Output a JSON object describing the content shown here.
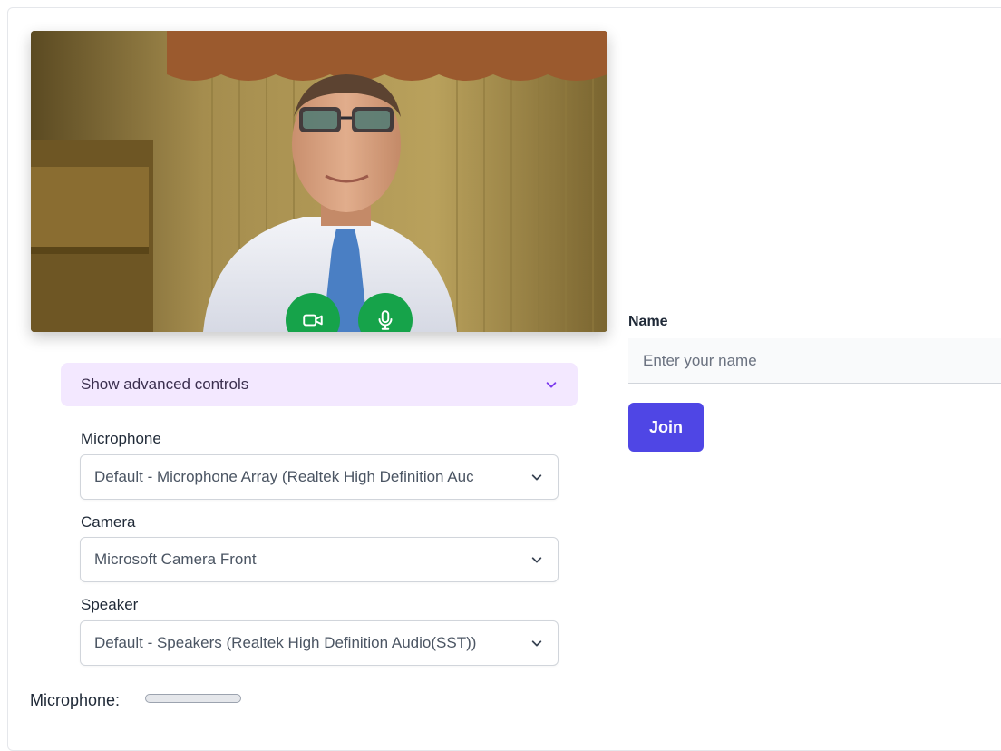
{
  "video_controls": {
    "camera_button": "camera-icon",
    "microphone_button": "microphone-icon",
    "accent_color": "#16a34a"
  },
  "advanced": {
    "toggle_label": "Show advanced controls",
    "background_color": "#f3e8ff"
  },
  "devices": {
    "microphone": {
      "label": "Microphone",
      "selected": "Default - Microphone Array (Realtek High Definition Auc"
    },
    "camera": {
      "label": "Camera",
      "selected": "Microsoft Camera Front"
    },
    "speaker": {
      "label": "Speaker",
      "selected": "Default - Speakers (Realtek High Definition Audio(SST))"
    }
  },
  "join_form": {
    "name_label": "Name",
    "name_placeholder": "Enter your name",
    "name_value": "",
    "join_label": "Join",
    "join_color": "#4f46e5"
  },
  "mic_level": {
    "label": "Microphone:",
    "level": 0
  }
}
